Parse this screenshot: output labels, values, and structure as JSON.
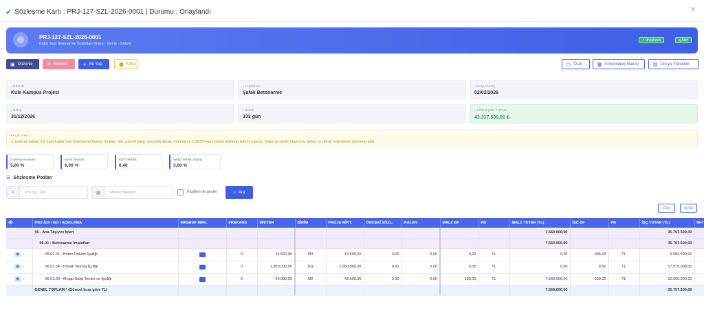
{
  "modal": {
    "title": "Sözleşme Kartı : PRJ-127-SZL-2026-0001 | Durumu : Onaylandı"
  },
  "banner": {
    "code": "PRJ-127-SZL-2026-0001",
    "description": "Kaba Yapı Betonarme İmalatları (Kalıp - Demir - Beton)",
    "badge_approved": "Onaylandı",
    "badge_active": "Aktif"
  },
  "toolbar": {
    "edit": "Düzenle",
    "reject": "Reddet",
    "addendum": "Ek Yap",
    "lock": "Kilitle",
    "summary": "Özet",
    "matrix": "Sorumluluk Matrisi",
    "files": "Dosya Yönetimi"
  },
  "info": {
    "project_label": "PROJE",
    "project_value": "Kule Kampüs Projesi",
    "subcontractor_label": "TAŞERON",
    "subcontractor_value": "Şafak Betonarme",
    "start_label": "BAŞLANGIÇ",
    "start_value": "02/02/2026",
    "end_label": "BİTİŞ",
    "end_value": "31/12/2026",
    "duration_label": "SÜRE",
    "duration_value": "333 gün",
    "amount_label": "SÖZLEŞME TUTARI",
    "amount_value": "43.317.500,00 ₺"
  },
  "description": {
    "label": "AÇIKLAMA",
    "text": "2. bodrum kattan 18. kata kadar tüm betonarme karkas imalatı; düz yüzeyli kalıp, nervürlü donatı montajı ve C30/37 hazır beton dökümü işlerini kapsar. Kalıp ve iskele taşerona, beton ve demir malzemesi işverene aittir."
  },
  "kpis": [
    {
      "label": "Güvence Kesintisi",
      "value": "5,00 %"
    },
    {
      "label": "Kesin Teminat",
      "value": "6,00 %"
    },
    {
      "label": "KDV Tevkifat",
      "value": "0,40"
    },
    {
      "label": "Vergi Tevkifat Stopajı",
      "value": "3,00 %"
    }
  ],
  "positions": {
    "title": "Sözleşme Pozları",
    "search_placeholder": "Poz No / Adı",
    "cost_center_placeholder": "Masraf Merkezi",
    "show_passive_label": "Pasifleri de göster",
    "search_button": "Ara",
    "csv": "CSV",
    "xlsx": "XLSX"
  },
  "table": {
    "headers": [
      "",
      "POZ ADI / NO / AÇIKLAMA",
      "MASRAF MRK.",
      "FREKANS",
      "MİKTAR",
      "BİRİM",
      "PROJE MİKT.",
      "ÖNCEKİ SÖZL.",
      "KALAN",
      "MALZ BF",
      "PB",
      "MALZ TUTAR (TL)",
      "İŞÇ BF",
      "PB",
      "İŞÇ TUTAR (TL)",
      "M+İ BF"
    ],
    "group1": {
      "name": "06 - Ana Taşıyıcı İşleri",
      "malz_total": "7.560.000,00",
      "isc_total": "35.757.500,00"
    },
    "group2": {
      "name": "06.01 - Betonarme İmalatları",
      "malz_total": "7.560.000,00",
      "isc_total": "35.757.500,00"
    },
    "rows": [
      {
        "idx": "1",
        "name": "06.01.01 - Beton Döküm İşçiliği",
        "freq": "0",
        "qty": "14.500,00",
        "unit": "M3",
        "proj": "14.500,00",
        "prev": "0,00",
        "rem": "0,00",
        "malz_bf": "0,00",
        "pb1": "TL",
        "malz_tutar": "0,00",
        "isc_bf": "385,00",
        "pb2": "TL",
        "isc_tutar": "5.582.500,00",
        "mi": "-"
      },
      {
        "idx": "2",
        "name": "06.01.04 - Donatı Montaj İşçiliği",
        "freq": "0",
        "qty": "1.850.000,00",
        "unit": "KG",
        "proj": "1.850.000,00",
        "prev": "0,00",
        "rem": "0,00",
        "malz_bf": "0,00",
        "pb1": "TL",
        "malz_tutar": "0,00",
        "isc_bf": "9,50",
        "pb2": "TL",
        "isc_tutar": "17.575.000,00",
        "mi": "-"
      },
      {
        "idx": "3",
        "name": "06.01.09 - Ahşap Kalıp Temini ve İşçiliği",
        "freq": "0",
        "qty": "42.000,00",
        "unit": "M2",
        "proj": "42.000,00",
        "prev": "0,00",
        "rem": "0,00",
        "malz_bf": "180,00",
        "pb1": "TL",
        "malz_tutar": "7.560.000,00",
        "isc_bf": "300,00",
        "pb2": "TL",
        "isc_tutar": "12.600.000,00",
        "mi": "-"
      }
    ],
    "total": {
      "label": "GENEL TOPLAM * (Güncel kura göre TL)",
      "malz_total": "7.560.000,00",
      "isc_total": "35.757.500,00"
    }
  }
}
